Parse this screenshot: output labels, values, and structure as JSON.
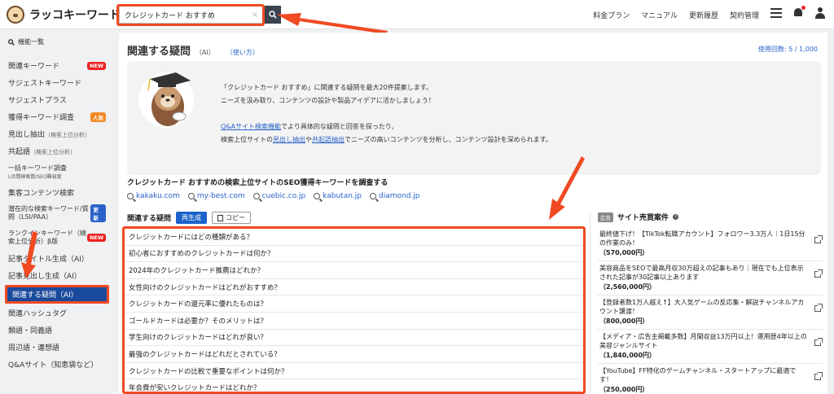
{
  "header": {
    "app_name": "ラッコキーワード",
    "search_value": "クレジットカード おすすめ",
    "nav": [
      "料金プラン",
      "マニュアル",
      "更新履歴",
      "契約管理"
    ]
  },
  "sidebar": {
    "section_title": "機能一覧",
    "items": [
      {
        "label": "関連キーワード",
        "badge": "NEW",
        "badge_color": "red"
      },
      {
        "label": "サジェストキーワード"
      },
      {
        "label": "サジェストプラス"
      },
      {
        "label": "獲得キーワード調査",
        "badge": "人気",
        "badge_color": "orange"
      },
      {
        "label": "見出し抽出",
        "sub": "（検索上位分析）"
      },
      {
        "label": "共起語",
        "sub": "（検索上位分析）"
      },
      {
        "label": "一括キーワード調査",
        "sub2": "L月間検索数/SEO難易度"
      },
      {
        "label": "集客コンテンツ検索"
      },
      {
        "label": "潜在的な検索キーワード/質問（LSI/PAA）",
        "badge": "更新",
        "badge_color": "blue"
      },
      {
        "label": "ランクインキーワード（検索上位分析）β版",
        "badge": "NEW",
        "badge_color": "red"
      },
      {
        "label": "記事タイトル生成（AI）"
      },
      {
        "label": "記事見出し生成（AI）"
      },
      {
        "label": "関連する疑問（AI）",
        "active": true
      },
      {
        "label": "関連ハッシュタグ"
      },
      {
        "label": "類語・同義語"
      },
      {
        "label": "周辺語・連想語"
      },
      {
        "label": "Q&Aサイト（知恵袋など）"
      }
    ]
  },
  "main": {
    "title": "関連する疑問",
    "title_suffix": "（AI）",
    "howto": "（使い方）",
    "usage": "使用回数: 5 / 1,000",
    "intro": {
      "line1": "「クレジットカード おすすめ」に関連する疑問を最大20件提案します。",
      "line2": "ニーズを汲み取り、コンテンツの設計や製品アイデアに活かしましょう！",
      "line3_link": "Q&Aサイト検索機能",
      "line3_rest": "でより具体的な疑問と回答を探ったり、",
      "line4_pre": "検索上位サイトの",
      "line4_link1": "見出し抽出",
      "line4_mid": "や",
      "line4_link2": "共起語抽出",
      "line4_rest": "でニーズの高いコンテンツを分析し、コンテンツ設計を深められます。"
    },
    "seo_title": "クレジットカード おすすめの検索上位サイトのSEO獲得キーワードを調査する",
    "seo_links": [
      "kakaku.com",
      "my-best.com",
      "cuebic.co.jp",
      "kabutan.jp",
      "diamond.jp"
    ],
    "questions_label": "関連する疑問",
    "regen_label": "再生成",
    "copy_label": "コピー",
    "questions": [
      "クレジットカードにはどの種類がある？",
      "初心者におすすめのクレジットカードは何か？",
      "2024年のクレジットカード推薦はどれか？",
      "女性向けのクレジットカードはどれがおすすめ？",
      "クレジットカードの還元率に優れたものは？",
      "ゴールドカードは必要か？そのメリットは？",
      "学生向けのクレジットカードはどれが良い？",
      "最強のクレジットカードはどれだとされている？",
      "クレジットカードの比較で重要なポイントは何か？",
      "年会費が安いクレジットカードはどれか？"
    ]
  },
  "ad_panel": {
    "badge": "広告",
    "title": "サイト売買案件",
    "items": [
      {
        "text": "最終値下げ！【TikTok転職アカウント】フォロワー3.3万人｜1日15分の作業のみ！",
        "price": "（570,000円）"
      },
      {
        "text": "美容商品をSEOで最高月収30万超えの記事もあり｜現在でも上位表示された記事が30記事以上あります",
        "price": "（2,560,000円）"
      },
      {
        "text": "【登録者数1万人越え↑】大人気ゲームの反応集・解説チャンネルアカウント譲渡！",
        "price": "（800,000円）"
      },
      {
        "text": "【メディア・広告主掲載多数】月間収益13万円以上！運用歴4年以上の美容ジャンルサイト",
        "price": "（1,840,000円）"
      },
      {
        "text": "【YouTube】FF特化のゲームチャンネル・スタートアップに最適です！",
        "price": "（250,000円）"
      }
    ]
  },
  "colors": {
    "accent_blue": "#2a62c9",
    "active_nav": "#1a4a9c",
    "highlight_red": "#f04a23"
  }
}
